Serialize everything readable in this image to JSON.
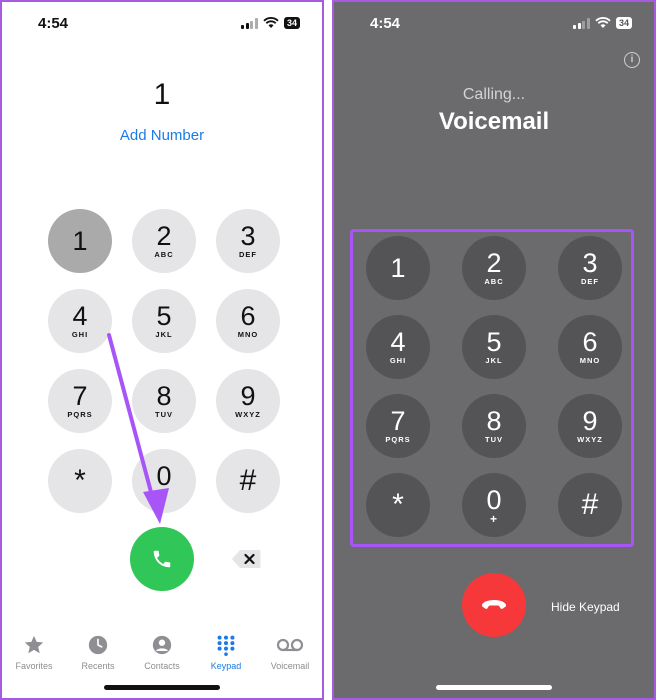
{
  "left_screen": {
    "status_time": "4:54",
    "battery": "34",
    "dialed_number": "1",
    "add_number": "Add Number",
    "keys": [
      {
        "digit": "1",
        "letters": ""
      },
      {
        "digit": "2",
        "letters": "ABC"
      },
      {
        "digit": "3",
        "letters": "DEF"
      },
      {
        "digit": "4",
        "letters": "GHI"
      },
      {
        "digit": "5",
        "letters": "JKL"
      },
      {
        "digit": "6",
        "letters": "MNO"
      },
      {
        "digit": "7",
        "letters": "PQRS"
      },
      {
        "digit": "8",
        "letters": "TUV"
      },
      {
        "digit": "9",
        "letters": "WXYZ"
      },
      {
        "digit": "*",
        "letters": ""
      },
      {
        "digit": "0",
        "letters": "+"
      },
      {
        "digit": "#",
        "letters": ""
      }
    ],
    "pressed_key": "1",
    "tabs": [
      {
        "label": "Favorites",
        "icon": "star-icon"
      },
      {
        "label": "Recents",
        "icon": "clock-icon"
      },
      {
        "label": "Contacts",
        "icon": "person-icon"
      },
      {
        "label": "Keypad",
        "icon": "keypad-icon"
      },
      {
        "label": "Voicemail",
        "icon": "voicemail-icon"
      }
    ],
    "active_tab": "Keypad"
  },
  "right_screen": {
    "status_time": "4:54",
    "battery": "34",
    "calling_status": "Calling...",
    "contact_name": "Voicemail",
    "keys": [
      {
        "digit": "1",
        "letters": ""
      },
      {
        "digit": "2",
        "letters": "ABC"
      },
      {
        "digit": "3",
        "letters": "DEF"
      },
      {
        "digit": "4",
        "letters": "GHI"
      },
      {
        "digit": "5",
        "letters": "JKL"
      },
      {
        "digit": "6",
        "letters": "MNO"
      },
      {
        "digit": "7",
        "letters": "PQRS"
      },
      {
        "digit": "8",
        "letters": "TUV"
      },
      {
        "digit": "9",
        "letters": "WXYZ"
      },
      {
        "digit": "*",
        "letters": ""
      },
      {
        "digit": "0",
        "letters": "+"
      },
      {
        "digit": "#",
        "letters": ""
      }
    ],
    "hide_keypad": "Hide Keypad"
  },
  "colors": {
    "accent_blue": "#1a7ce8",
    "call_green": "#31c758",
    "end_red": "#f6383b",
    "annotation_purple": "#a855f7"
  }
}
